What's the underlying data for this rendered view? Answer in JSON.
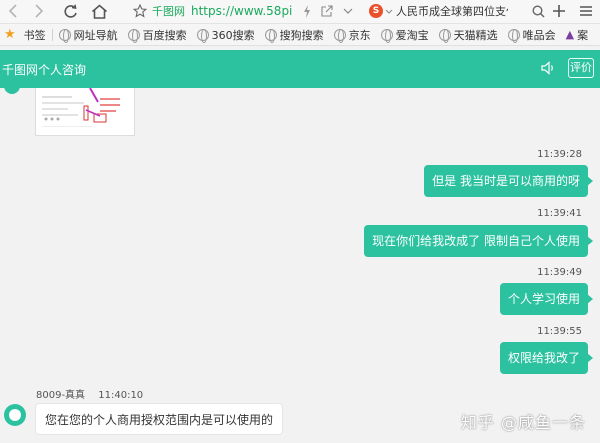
{
  "browser": {
    "url_site": "千图网",
    "url_text": "https://www.58pi",
    "tab_title": "人民币成全球第四位支付货",
    "search_logo": "S"
  },
  "bookmarks": {
    "label": "书签",
    "items": [
      "网址导航",
      "百度搜索",
      "360搜索",
      "搜狗搜索",
      "京东",
      "爱淘宝",
      "天猫精选",
      "唯品会",
      "案"
    ]
  },
  "chat": {
    "title": "千图网个人咨询",
    "rate_label": "评价",
    "messages": [
      {
        "time": "11:39:28",
        "text": "但是 我当时是可以商用的呀"
      },
      {
        "time": "11:39:41",
        "text": "现在你们给我改成了 限制自己个人使用"
      },
      {
        "time": "11:39:49",
        "text": "个人学习使用"
      },
      {
        "time": "11:39:55",
        "text": "权限给我改了"
      }
    ],
    "reply": {
      "sender": "8009-真真",
      "time": "11:40:10",
      "text": "您在您的个人商用授权范围内是可以使用的"
    }
  },
  "watermark": "知乎 @咸鱼一条",
  "colors": {
    "accent": "#2cc2a0",
    "url_green": "#19a95c",
    "search_red": "#e8512a"
  }
}
